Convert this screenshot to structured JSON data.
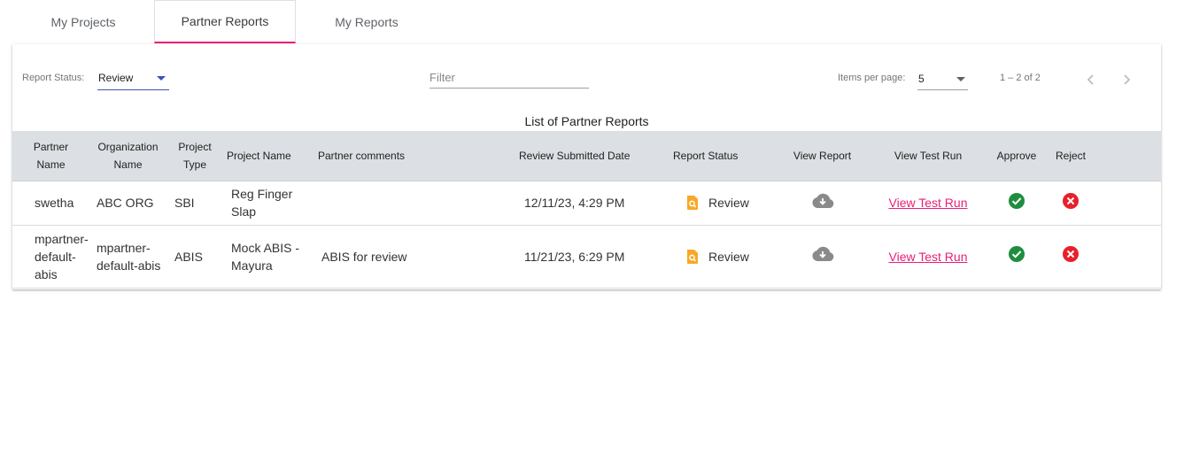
{
  "tabs": [
    {
      "label": "My Projects",
      "active": false
    },
    {
      "label": "Partner Reports",
      "active": true
    },
    {
      "label": "My Reports",
      "active": false
    }
  ],
  "toolbar": {
    "status_label": "Report Status:",
    "status_value": "Review",
    "filter_placeholder": "Filter",
    "items_per_page_label": "Items per page:",
    "items_per_page_value": "5",
    "range_text": "1 – 2 of 2"
  },
  "table": {
    "title": "List of Partner Reports",
    "columns": [
      "Partner Name",
      "Organization Name",
      "Project Type",
      "Project Name",
      "Partner comments",
      "Review Submitted Date",
      "Report Status",
      "View Report",
      "View Test Run",
      "Approve",
      "Reject"
    ],
    "rows": [
      {
        "partner": "swetha",
        "org": "ABC ORG",
        "type": "SBI",
        "project": "Reg Finger Slap",
        "comments": "",
        "date": "12/11/23, 4:29 PM",
        "status": "Review",
        "test_run": "View Test Run"
      },
      {
        "partner": "mpartner-default-abis",
        "org": "mpartner-default-abis",
        "type": "ABIS",
        "project": "Mock ABIS - Mayura",
        "comments": "ABIS for review",
        "date": "11/21/23, 6:29 PM",
        "status": "Review",
        "test_run": "View Test Run"
      }
    ]
  },
  "colors": {
    "accent": "#e91e78",
    "approve": "#1e8e3e",
    "reject": "#e8202a",
    "review_icon": "#f9a825",
    "download_icon": "#8a8a8a"
  },
  "icons": {
    "review": "review-doc-icon",
    "download": "cloud-download-icon",
    "approve": "check-circle-icon",
    "reject": "cancel-circle-icon"
  }
}
